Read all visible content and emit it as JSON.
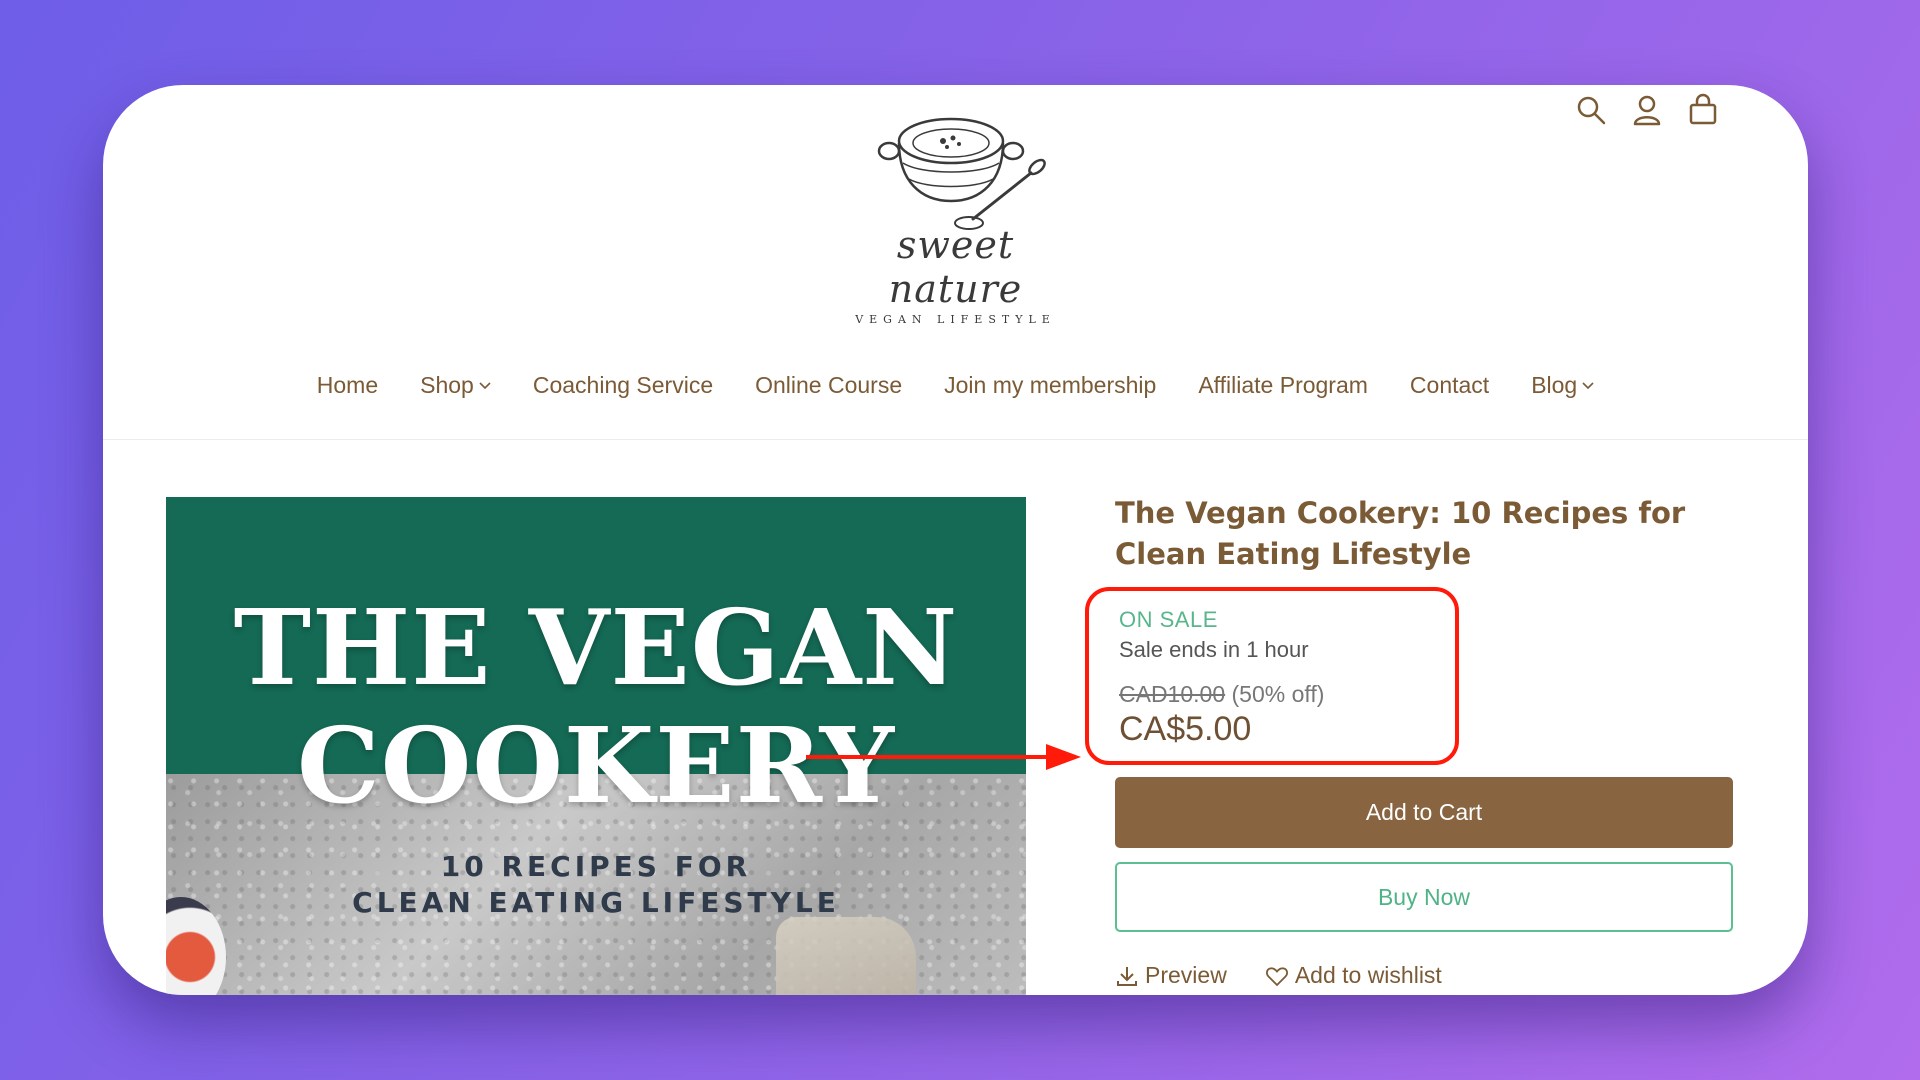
{
  "logo": {
    "script_text": "sweet nature",
    "sub_text": "VEGAN LIFESTYLE"
  },
  "header": {
    "icons": [
      "search-icon",
      "account-icon",
      "cart-icon"
    ]
  },
  "nav": {
    "items": [
      {
        "label": "Home",
        "has_dropdown": false
      },
      {
        "label": "Shop",
        "has_dropdown": true
      },
      {
        "label": "Coaching Service",
        "has_dropdown": false
      },
      {
        "label": "Online Course",
        "has_dropdown": false
      },
      {
        "label": "Join my membership",
        "has_dropdown": false
      },
      {
        "label": "Affiliate Program",
        "has_dropdown": false
      },
      {
        "label": "Contact",
        "has_dropdown": false
      },
      {
        "label": "Blog",
        "has_dropdown": true
      }
    ]
  },
  "cover": {
    "title_line1": "THE VEGAN",
    "title_line2": "COOKERY",
    "sub_line1": "10 RECIPES FOR",
    "sub_line2": "CLEAN EATING LIFESTYLE"
  },
  "product": {
    "title": "The Vegan Cookery: 10 Recipes for Clean Eating Lifestyle",
    "sale_label": "ON SALE",
    "sale_ends": "Sale ends in 1 hour",
    "old_price": "CAD10.00",
    "discount": "(50% off)",
    "price": "CA$5.00",
    "add_to_cart": "Add to Cart",
    "buy_now": "Buy Now",
    "preview": "Preview",
    "wishlist": "Add to wishlist"
  },
  "colors": {
    "accent_brown": "#896440",
    "text_brown": "#7b5a36",
    "sale_green": "#58b68c",
    "highlight_red": "#ff1a0a",
    "cover_green": "#146a55"
  }
}
